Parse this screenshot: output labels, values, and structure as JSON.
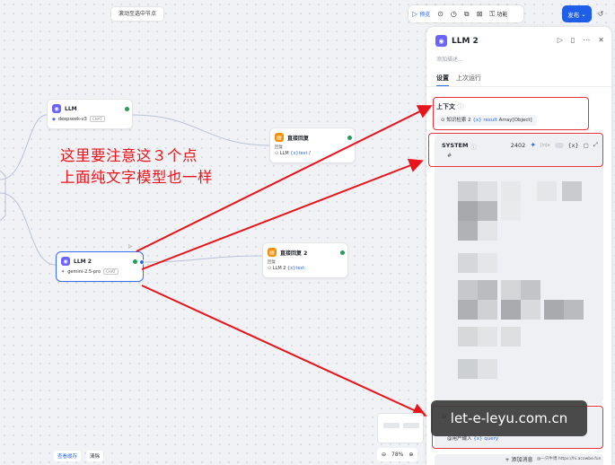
{
  "top_pill": "滚动至选中节点",
  "toolbar": {
    "preview": "预览",
    "features": "功能",
    "publish": "发布"
  },
  "nodes": {
    "llm1": {
      "title": "LLM",
      "model": "deepseek-v3",
      "tag": "CHAT"
    },
    "reply1": {
      "title": "直接回复",
      "sub": "回复",
      "var_prefix": "LLM",
      "var": "{x}text",
      "var_suffix": "/"
    },
    "llm2": {
      "title": "LLM 2",
      "model": "gemini-2.5-pro",
      "tag": "CHAT"
    },
    "reply2": {
      "title": "直接回复 2",
      "sub": "回复",
      "var_prefix": "LLM 2",
      "var": "{x}text"
    }
  },
  "annotation": {
    "line1": "这里要注意这３个点",
    "line2": "上面纯文字模型也一样"
  },
  "panel": {
    "title": "LLM 2",
    "description_placeholder": "添加描述...",
    "tabs": [
      "设置",
      "上次运行"
    ],
    "context_label": "上下文",
    "context_chip": {
      "source": "知识检索 2",
      "var": "{x} result",
      "type": "Array[Object]"
    },
    "system_label": "SYSTEM",
    "token_count": "2402",
    "jinja_label": "Jinja",
    "user_input": "@用户输入",
    "user_var": "{x} query",
    "add_message": "添加消息"
  },
  "watermark": "let-e-leyu.com.cn",
  "credit": "@一只牛博 https://hi.acowbo.fun",
  "zoom": "78%",
  "bottom_bar": {
    "view_cache": "查看缓存",
    "clear": "清除"
  }
}
